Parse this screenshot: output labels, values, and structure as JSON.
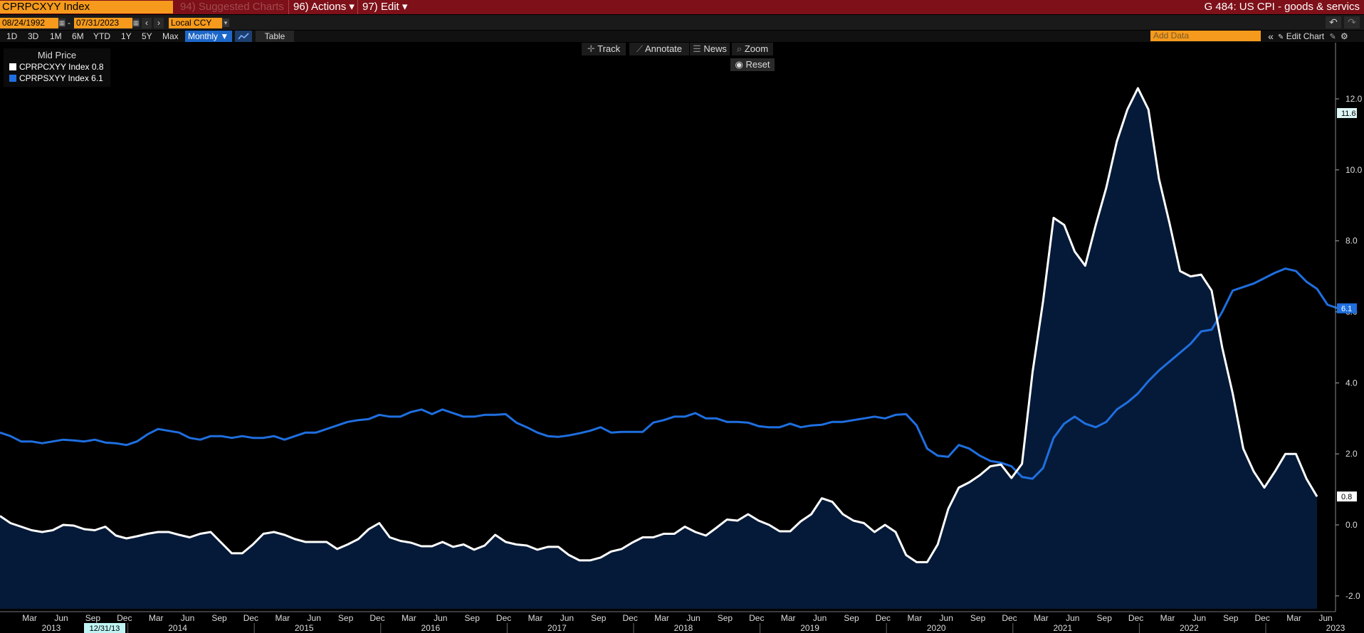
{
  "toolbar": {
    "ticker": "CPRPCXYY  Index",
    "suggested_charts": "94) Suggested Charts",
    "actions": "96) Actions ▾",
    "edit": "97) Edit ▾",
    "title": "G 484: US CPI - goods & servics"
  },
  "date_bar": {
    "start_date": "08/24/1992",
    "dash": "-",
    "end_date": "07/31/2023",
    "prev": "‹",
    "next": "›",
    "currency": "Local CCY",
    "currency_arrow": "▾",
    "undo": "↶",
    "redo": "↷"
  },
  "range_bar": {
    "ranges": [
      "1D",
      "3D",
      "1M",
      "6M",
      "YTD",
      "1Y",
      "5Y",
      "Max"
    ],
    "frequency": "Monthly ▼",
    "chart_type_icon": "line-chart-icon",
    "table": "Table",
    "add_data_placeholder": "Add Data",
    "collapse": "«",
    "edit_chart": "Edit Chart",
    "pencil": "✎",
    "gear": "⚙"
  },
  "chart_tools": {
    "track": "Track",
    "annotate": "Annotate",
    "news": "News",
    "zoom": "Zoom",
    "reset": "Reset"
  },
  "legend": {
    "title": "Mid Price",
    "items": [
      {
        "label": "CPRPCXYY Index 0.8",
        "color": "#ffffff"
      },
      {
        "label": "CPRPSXYY Index 6.1",
        "color": "#1f6fe0"
      }
    ]
  },
  "cursor_date_label": "12/31/13",
  "chart_data": {
    "type": "line",
    "title": "",
    "xlabel": "",
    "ylabel": "",
    "ylim": [
      -2.4,
      13.8
    ],
    "yticks": [
      "12.0",
      "10.0",
      "8.0",
      "6.0",
      "4.0",
      "2.0",
      "0.0",
      "-2.0"
    ],
    "x_months": [
      "Mar",
      "Jun",
      "Sep",
      "Dec"
    ],
    "x_years": [
      "2013",
      "2014",
      "2015",
      "2016",
      "2017",
      "2018",
      "2019",
      "2020",
      "2021",
      "2022",
      "2023"
    ],
    "x_start": "2013-01",
    "x_end": "2023-07",
    "last_values": {
      "CPRPCXYY Index": "0.8",
      "CPRPSXYY Index": "6.1"
    },
    "other_label": "11.6",
    "grid": false,
    "legend_position": "top-left",
    "series": [
      {
        "name": "CPRPCXYY Index",
        "color": "#ffffff",
        "fill": "#051a38",
        "values": [
          0.25,
          0.05,
          -0.05,
          -0.15,
          -0.2,
          -0.15,
          0.0,
          -0.02,
          -0.12,
          -0.15,
          -0.05,
          -0.3,
          -0.38,
          -0.32,
          -0.25,
          -0.2,
          -0.2,
          -0.28,
          -0.35,
          -0.25,
          -0.2,
          -0.5,
          -0.8,
          -0.8,
          -0.55,
          -0.25,
          -0.2,
          -0.28,
          -0.4,
          -0.48,
          -0.48,
          -0.48,
          -0.68,
          -0.55,
          -0.4,
          -0.12,
          0.05,
          -0.35,
          -0.45,
          -0.5,
          -0.6,
          -0.6,
          -0.48,
          -0.62,
          -0.55,
          -0.7,
          -0.58,
          -0.28,
          -0.48,
          -0.55,
          -0.58,
          -0.7,
          -0.62,
          -0.62,
          -0.85,
          -1.0,
          -1.0,
          -0.92,
          -0.75,
          -0.68,
          -0.5,
          -0.35,
          -0.35,
          -0.25,
          -0.25,
          -0.05,
          -0.2,
          -0.3,
          -0.08,
          0.15,
          0.12,
          0.3,
          0.12,
          0.0,
          -0.18,
          -0.18,
          0.1,
          0.3,
          0.75,
          0.65,
          0.3,
          0.12,
          0.05,
          -0.2,
          0.0,
          -0.2,
          -0.85,
          -1.05,
          -1.05,
          -0.55,
          0.45,
          1.05,
          1.2,
          1.4,
          1.65,
          1.7,
          1.32,
          1.72,
          4.3,
          6.3,
          8.65,
          8.45,
          7.7,
          7.3,
          8.45,
          9.5,
          10.8,
          11.7,
          12.3,
          11.7,
          9.75,
          8.5,
          7.15,
          7.0,
          7.05,
          6.6,
          5.0,
          3.7,
          2.15,
          1.5,
          1.05,
          1.5,
          2.0,
          2.0,
          1.3,
          0.8
        ]
      },
      {
        "name": "CPRPSXYY Index",
        "color": "#1f6fe0",
        "values": [
          2.6,
          2.5,
          2.35,
          2.35,
          2.3,
          2.35,
          2.4,
          2.38,
          2.35,
          2.4,
          2.32,
          2.3,
          2.25,
          2.35,
          2.55,
          2.7,
          2.65,
          2.6,
          2.45,
          2.4,
          2.5,
          2.5,
          2.45,
          2.5,
          2.45,
          2.45,
          2.5,
          2.4,
          2.5,
          2.6,
          2.6,
          2.7,
          2.8,
          2.9,
          2.95,
          2.98,
          3.1,
          3.05,
          3.05,
          3.18,
          3.25,
          3.12,
          3.25,
          3.15,
          3.05,
          3.05,
          3.1,
          3.1,
          3.12,
          2.88,
          2.75,
          2.6,
          2.5,
          2.48,
          2.52,
          2.58,
          2.65,
          2.75,
          2.6,
          2.62,
          2.62,
          2.62,
          2.88,
          2.95,
          3.05,
          3.05,
          3.15,
          3.0,
          3.0,
          2.9,
          2.9,
          2.88,
          2.78,
          2.75,
          2.75,
          2.85,
          2.75,
          2.8,
          2.82,
          2.9,
          2.9,
          2.95,
          3.0,
          3.05,
          3.0,
          3.1,
          3.12,
          2.8,
          2.15,
          1.95,
          1.92,
          2.25,
          2.15,
          1.95,
          1.8,
          1.75,
          1.65,
          1.35,
          1.3,
          1.6,
          2.45,
          2.85,
          3.05,
          2.85,
          2.75,
          2.9,
          3.25,
          3.45,
          3.7,
          4.05,
          4.35,
          4.6,
          4.85,
          5.1,
          5.45,
          5.5,
          6.0,
          6.6,
          6.7,
          6.8,
          6.95,
          7.1,
          7.22,
          7.15,
          6.85,
          6.65,
          6.2,
          6.1
        ]
      }
    ]
  }
}
